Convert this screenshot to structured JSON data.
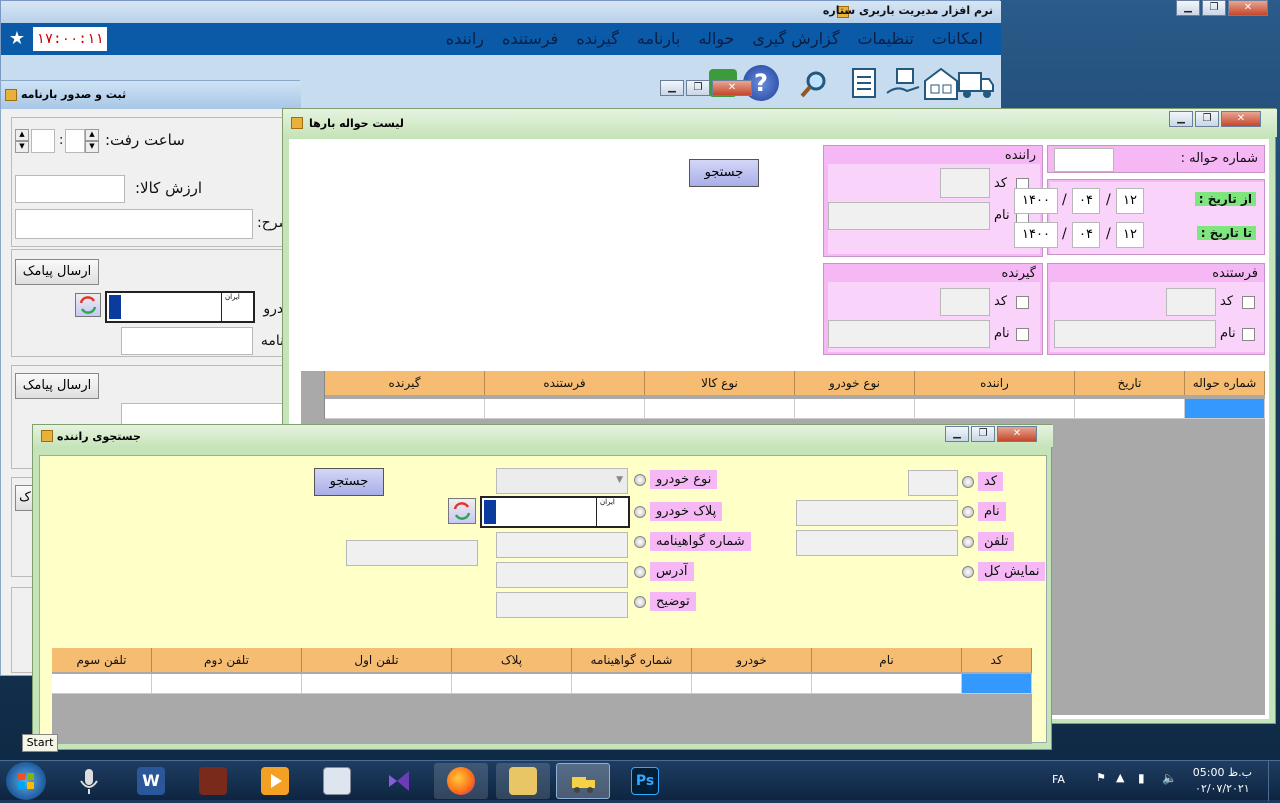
{
  "main": {
    "title": "نرم افزار مدیریت باربری ستاره",
    "clock": "۱۷:۰۰:۱۱",
    "menu": [
      "راننده",
      "فرستنده",
      "گیرنده",
      "بارنامه",
      "حواله",
      "گزارش گیری",
      "تنظیمات",
      "امکانات"
    ]
  },
  "waybill": {
    "title": "ثبت و صدور بارنامه",
    "departure_time_label": "ساعت رفت:",
    "time_sep": ":",
    "goods_value_label": "ارزش کالا:",
    "desc_label": "شرح:",
    "send_sms_1": "ارسال پیامک",
    "vehicle_label": "خودرو :",
    "waybill_no_label": "بارنامه :",
    "send_sms_2": "ارسال پیامک",
    "partial_btn": "ک"
  },
  "remittance": {
    "title": "لیست حواله بارها",
    "search_button": "جستجو",
    "remit_no_label": "شماره حواله :",
    "driver_group": "راننده",
    "code_label": "کد",
    "name_label": "نام",
    "from_date_label": "از تاریخ :",
    "to_date_label": "تا تاریخ :",
    "from_date": {
      "day": "۱۲",
      "month": "۰۴",
      "year": "۱۴۰۰"
    },
    "to_date": {
      "day": "۱۲",
      "month": "۰۴",
      "year": "۱۴۰۰"
    },
    "date_sep": "/",
    "receiver_group": "گیرنده",
    "sender_group": "فرستنده",
    "columns": [
      "شماره حواله",
      "تاریخ",
      "راننده",
      "نوع خودرو",
      "نوع کالا",
      "فرستنده",
      "گیرنده"
    ]
  },
  "driver_search": {
    "title": "جستجوی راننده",
    "search_button": "جستجو",
    "options_right": [
      "کد",
      "نام",
      "تلفن",
      "نمایش کل"
    ],
    "options_mid": [
      "نوع خودرو",
      "پلاک خودرو",
      "شماره گواهینامه",
      "آدرس",
      "توضیح"
    ],
    "columns": [
      "کد",
      "نام",
      "خودرو",
      "شماره گواهینامه",
      "پلاک",
      "تلفن اول",
      "تلفن دوم",
      "تلفن سوم"
    ]
  },
  "plate": {
    "country": "ایران",
    "code": "IR\nIRAN"
  },
  "taskbar": {
    "start_tooltip": "Start",
    "lang": "FA",
    "time": "05:00 ب.ظ",
    "date": "۰۲/۰۷/۲۰۲۱"
  }
}
